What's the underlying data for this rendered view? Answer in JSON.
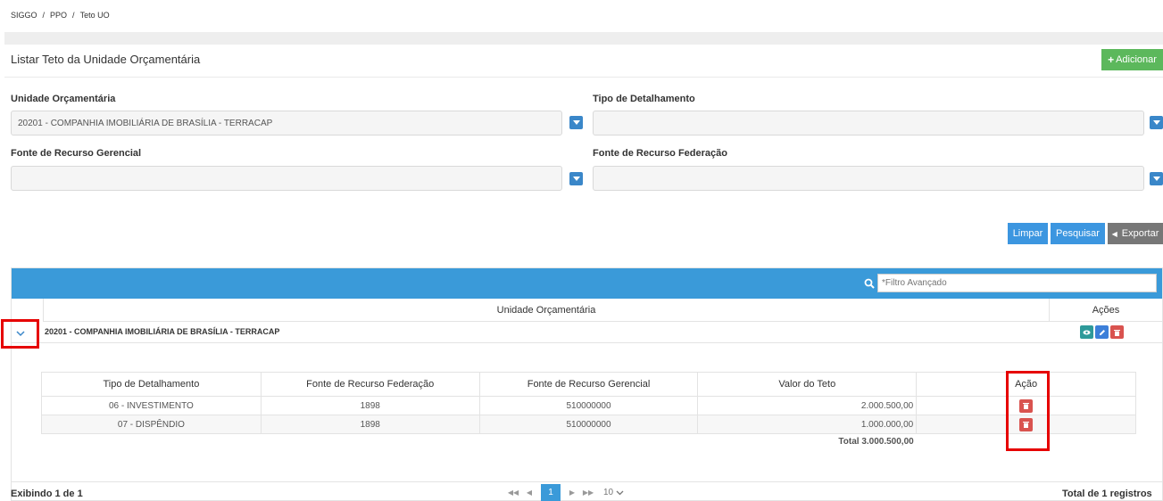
{
  "breadcrumb": [
    "SIGGO",
    "PPO",
    "Teto UO"
  ],
  "page": {
    "title": "Listar Teto da Unidade Orçamentária",
    "add_label": "Adicionar"
  },
  "filters": {
    "unidade_label": "Unidade Orçamentária",
    "unidade_value": "20201 - COMPANHIA IMOBILIÁRIA DE BRASÍLIA - TERRACAP",
    "tipo_label": "Tipo de Detalhamento",
    "tipo_value": "",
    "fonte_ger_label": "Fonte de Recurso Gerencial",
    "fonte_ger_value": "",
    "fonte_fed_label": "Fonte de Recurso Federação",
    "fonte_fed_value": ""
  },
  "actions": {
    "limpar": "Limpar",
    "pesquisar": "Pesquisar",
    "exportar": "Exportar"
  },
  "grid": {
    "search_placeholder": "*Filtro Avançado",
    "col_unidade": "Unidade Orçamentária",
    "col_acoes": "Ações",
    "group_label": "20201 - COMPANHIA IMOBILIÁRIA DE BRASÍLIA - TERRACAP",
    "sub_headers": [
      "Tipo de Detalhamento",
      "Fonte de Recurso Federação",
      "Fonte de Recurso Gerencial",
      "Valor do Teto",
      "Ação"
    ],
    "rows": [
      {
        "tipo": "06 - INVESTIMENTO",
        "federacao": "1898",
        "gerencial": "510000000",
        "valor": "2.000.500,00"
      },
      {
        "tipo": "07 - DISPÊNDIO",
        "federacao": "1898",
        "gerencial": "510000000",
        "valor": "1.000.000,00"
      }
    ],
    "total": "Total 3.000.500,00"
  },
  "footer": {
    "exibindo": "Exibindo 1 de 1",
    "current_page": "1",
    "page_size": "10",
    "total_registros": "Total de 1 registros"
  },
  "colors": {
    "primary": "#3a9ad9",
    "success": "#5cb85c",
    "danger": "#d9534f",
    "highlight": "#e60000"
  }
}
